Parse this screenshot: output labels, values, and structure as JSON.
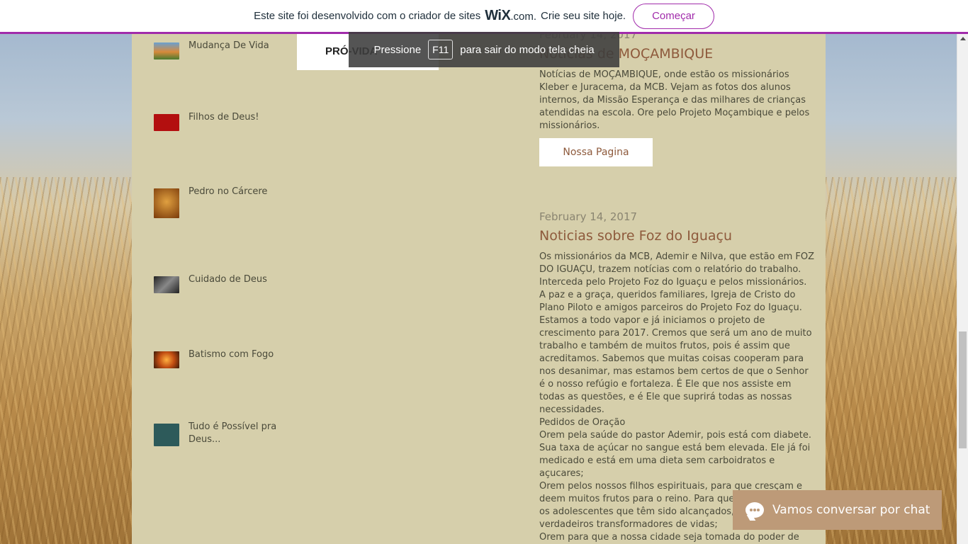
{
  "wix_banner": {
    "text_before": "Este site foi desenvolvido com o criador de sites",
    "logo": "WiX",
    "logo_suffix": ".com.",
    "text_after": "Crie seu site hoje.",
    "start_button": "Começar"
  },
  "fullscreen_hint": {
    "press": "Pressione",
    "key": "F11",
    "message": "para sair do modo tela cheia"
  },
  "sidebar": {
    "items": [
      {
        "title": "Mudança De Vida",
        "thumb_color": "#5a7a48"
      },
      {
        "title": "Filhos de Deus!",
        "thumb_color": "#b30f0f"
      },
      {
        "title": "Pedro no Cárcere",
        "thumb_color": "#9a5a14"
      },
      {
        "title": "Cuidado de Deus",
        "thumb_color": "#3a3a3a"
      },
      {
        "title": "Batismo com Fogo",
        "thumb_color": "#c14d12"
      },
      {
        "title": "Tudo é Possível pra Deus...",
        "thumb_color": "#2d5a5a"
      }
    ]
  },
  "provida_image": {
    "text": "PRÓ-VIDA"
  },
  "posts": [
    {
      "date": "February 14, 2017",
      "title": "Notícias de MOÇAMBIQUE",
      "body": "Notícias de MOÇAMBIQUE, onde estão os missionários Kleber e Juracema, da MCB. Vejam as fotos dos alunos internos, da Missão Esperança e das milhares de crianças atendidas na escola. Ore pelo Projeto Moçambique e pelos missionários.",
      "button": "Nossa Pagina"
    },
    {
      "date": "February 14, 2017",
      "title": "Noticias sobre Foz do Iguaçu",
      "body": "Os missionários da MCB, Ademir e Nilva, que estão em FOZ DO IGUAÇU, trazem notícias com o relatório do trabalho. Interceda pelo Projeto Foz do Iguaçu e pelos missionários.\nA paz e a graça, queridos familiares, Igreja de Cristo do Plano Piloto e amigos parceiros do Projeto Foz do Iguaçu.\nEstamos a todo vapor e já iniciamos o projeto de crescimento para 2017. Cremos que será um ano de muito trabalho e também de muitos frutos, pois é assim que acreditamos. Sabemos que muitas coisas cooperam para nos desanimar, mas estamos bem certos de que o Senhor é o nosso refúgio e fortaleza. É Ele que nos assiste em todas as questões, e é Ele que suprirá todas as nossas necessidades.\nPedidos de Oração\nOrem pela saúde do pastor Ademir, pois está com diabete. Sua taxa de açúcar no sangue está bem elevada. Ele já foi medicado e está em uma dieta sem carboidratos e açucares;\nOrem pelos nossos filhos espirituais, para que cresçam e deem muitos frutos para o reino. Para que, principalmente, os adolescentes que têm sido alcançados, se tornem verdadeiros transformadores de vidas;\nOrem para que a nossa cidade seja tomada do poder de satanás. O tráfico de drogas, de produtos falsificados e a violência é a dura realidade em que convivem crianças e"
    }
  ],
  "chat": {
    "label": "Vamos conversar por chat"
  }
}
